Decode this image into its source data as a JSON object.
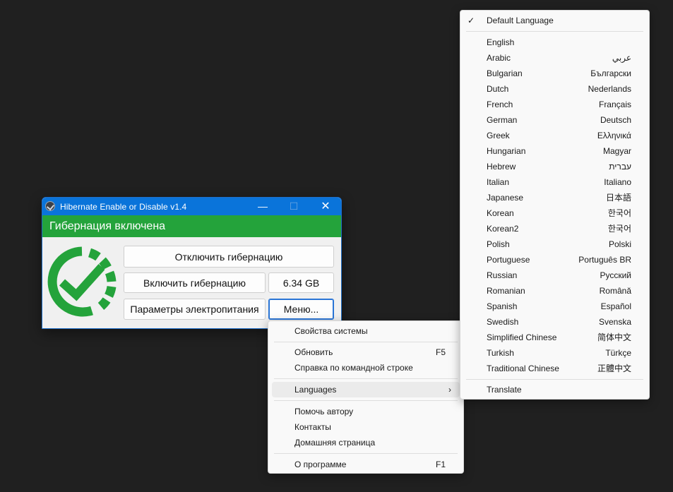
{
  "window": {
    "title": "Hibernate Enable or Disable v1.4",
    "controls": {
      "minimize": "—",
      "maximize": "☐",
      "close": "✕"
    },
    "status": "Гибернация включена",
    "buttons": {
      "disable": "Отключить гибернацию",
      "enable": "Включить гибернацию",
      "size": "6.34 GB",
      "power": "Параметры электропитания",
      "menu": "Меню..."
    },
    "colors": {
      "titlebar": "#0a74da",
      "status": "#24a33b",
      "logo": "#24a33b"
    }
  },
  "context_menu": {
    "items": [
      {
        "label": "Свойства системы",
        "shortcut": ""
      },
      {
        "label": "Обновить",
        "shortcut": "F5"
      },
      {
        "label": "Справка по командной строке",
        "shortcut": ""
      },
      {
        "label": "Languages",
        "shortcut": ""
      },
      {
        "label": "Помочь автору",
        "shortcut": ""
      },
      {
        "label": "Контакты",
        "shortcut": ""
      },
      {
        "label": "Домашняя страница",
        "shortcut": ""
      },
      {
        "label": "О программе",
        "shortcut": "F1"
      }
    ],
    "submenu_arrow": "›"
  },
  "languages_menu": {
    "checkmark": "✓",
    "default": "Default Language",
    "items": [
      {
        "label": "English",
        "native": ""
      },
      {
        "label": "Arabic",
        "native": "عربي"
      },
      {
        "label": "Bulgarian",
        "native": "Български"
      },
      {
        "label": "Dutch",
        "native": "Nederlands"
      },
      {
        "label": "French",
        "native": "Français"
      },
      {
        "label": "German",
        "native": "Deutsch"
      },
      {
        "label": "Greek",
        "native": "Ελληνικά"
      },
      {
        "label": "Hungarian",
        "native": "Magyar"
      },
      {
        "label": "Hebrew",
        "native": "עברית"
      },
      {
        "label": "Italian",
        "native": "Italiano"
      },
      {
        "label": "Japanese",
        "native": "日本語"
      },
      {
        "label": "Korean",
        "native": "한국어"
      },
      {
        "label": "Korean2",
        "native": "한국어"
      },
      {
        "label": "Polish",
        "native": "Polski"
      },
      {
        "label": "Portuguese",
        "native": "Português BR"
      },
      {
        "label": "Russian",
        "native": "Русский"
      },
      {
        "label": "Romanian",
        "native": "Română"
      },
      {
        "label": "Spanish",
        "native": "Español"
      },
      {
        "label": "Swedish",
        "native": "Svenska"
      },
      {
        "label": "Simplified Chinese",
        "native": "简体中文"
      },
      {
        "label": "Turkish",
        "native": "Türkçe"
      },
      {
        "label": "Traditional Chinese",
        "native": "正體中文"
      }
    ],
    "translate": "Translate"
  }
}
